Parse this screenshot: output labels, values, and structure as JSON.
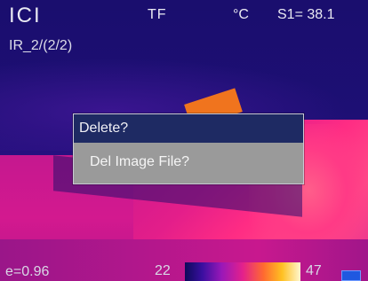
{
  "status_bar": {
    "brand": "ICI",
    "mode": "TF",
    "unit": "°C",
    "spot": "S1= 38.1",
    "file_label": "IR_2/(2/2)"
  },
  "footer": {
    "emissivity": "e=0.96",
    "scale_min": "22",
    "scale_max": "47"
  },
  "dialog": {
    "title": "Delete?",
    "message": "Del Image File?"
  },
  "colors": {
    "dialog_title_bg": "#1e2a63",
    "dialog_body_bg": "#9a9a9a",
    "battery": "#1f58e0"
  },
  "icons": {
    "battery": "battery-icon"
  }
}
